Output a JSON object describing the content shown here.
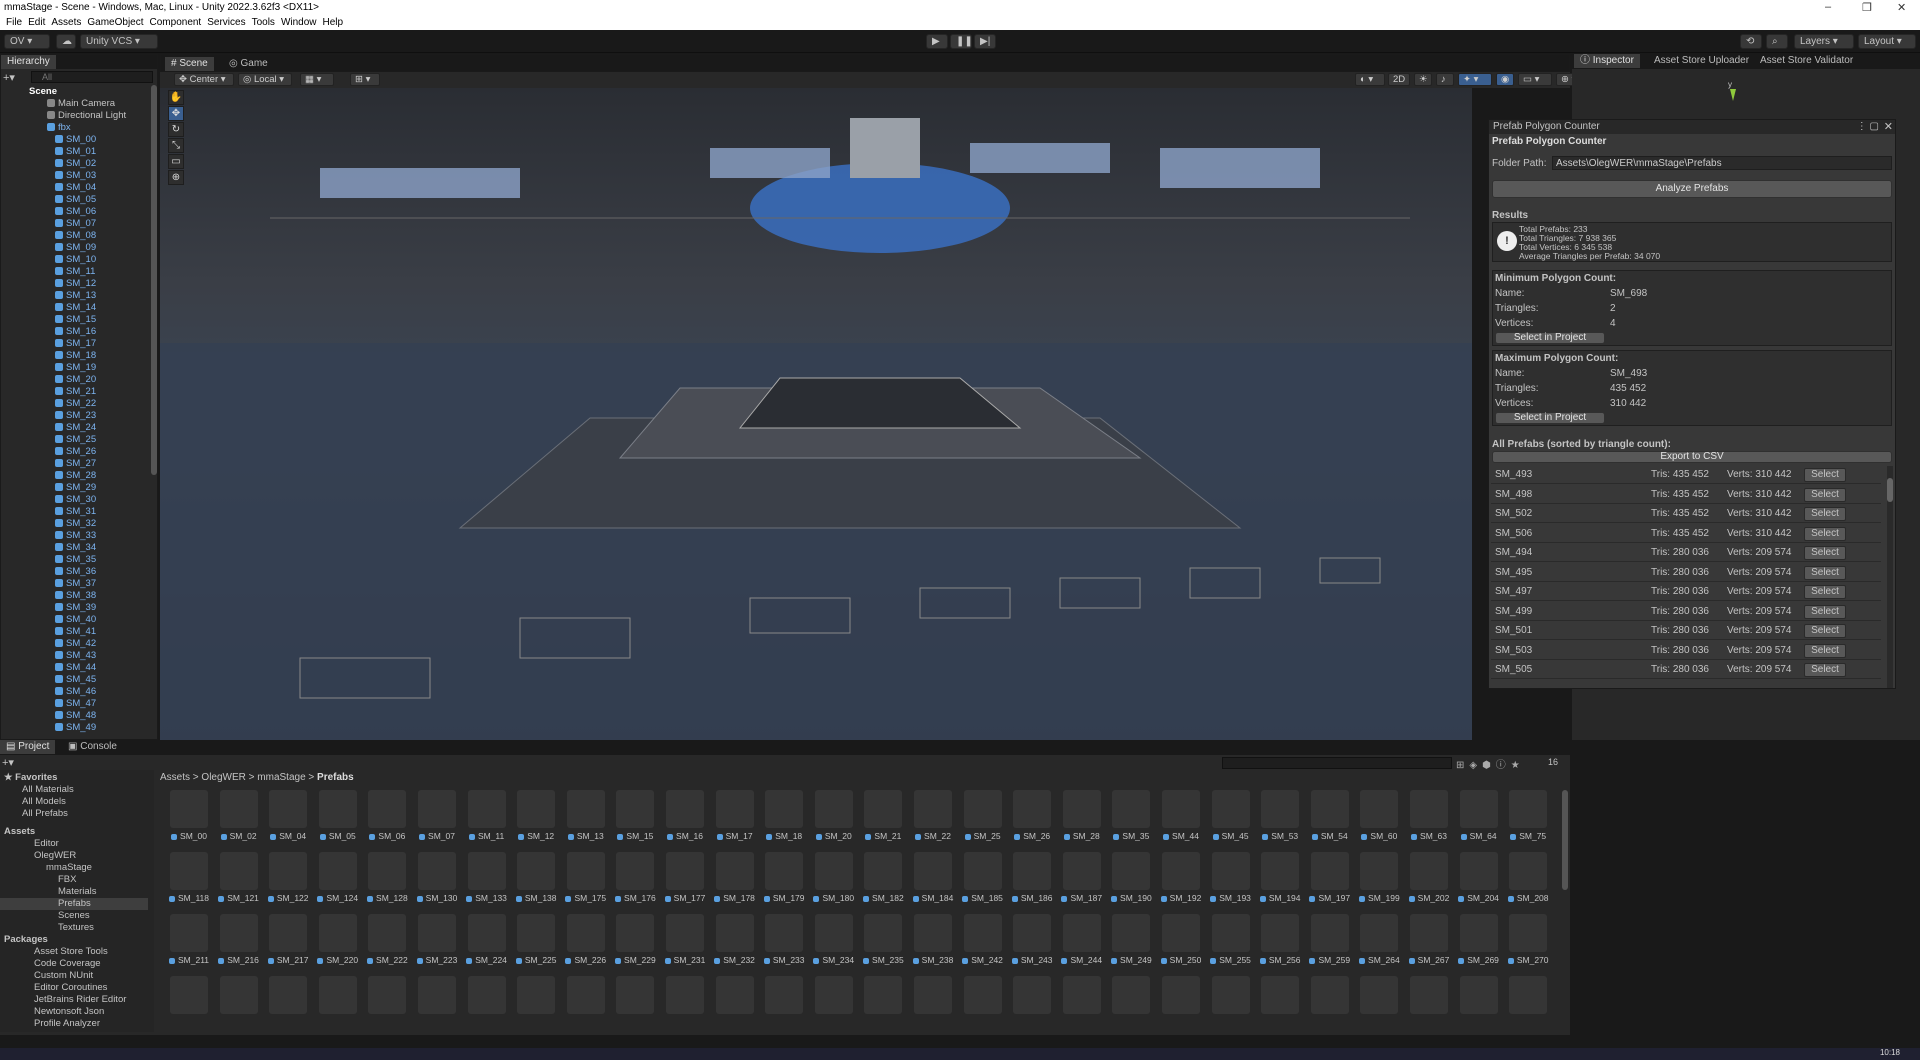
{
  "window": {
    "title": "mmaStage - Scene - Windows, Mac, Linux - Unity 2022.3.62f3 <DX11>"
  },
  "menu": [
    "File",
    "Edit",
    "Assets",
    "GameObject",
    "Component",
    "Services",
    "Tools",
    "Window",
    "Help"
  ],
  "toolbar": {
    "account": "OV",
    "vcs": "Unity VCS",
    "layers": "Layers",
    "layout": "Layout"
  },
  "hierarchy": {
    "tab": "Hierarchy",
    "search_placeholder": "All",
    "scene": "Scene",
    "main_camera": "Main Camera",
    "light": "Directional Light",
    "fbx": "fbx",
    "items": [
      "SM_00",
      "SM_01",
      "SM_02",
      "SM_03",
      "SM_04",
      "SM_05",
      "SM_06",
      "SM_07",
      "SM_08",
      "SM_09",
      "SM_10",
      "SM_11",
      "SM_12",
      "SM_13",
      "SM_14",
      "SM_15",
      "SM_16",
      "SM_17",
      "SM_18",
      "SM_19",
      "SM_20",
      "SM_21",
      "SM_22",
      "SM_23",
      "SM_24",
      "SM_25",
      "SM_26",
      "SM_27",
      "SM_28",
      "SM_29",
      "SM_30",
      "SM_31",
      "SM_32",
      "SM_33",
      "SM_34",
      "SM_35",
      "SM_36",
      "SM_37",
      "SM_38",
      "SM_39",
      "SM_40",
      "SM_41",
      "SM_42",
      "SM_43",
      "SM_44",
      "SM_45",
      "SM_46",
      "SM_47",
      "SM_48",
      "SM_49"
    ]
  },
  "scene": {
    "tab_scene": "Scene",
    "tab_game": "Game",
    "pivot": "Center",
    "space": "Local",
    "mode2d": "2D"
  },
  "inspector": {
    "tabs": [
      "Inspector",
      "Asset Store Uploader",
      "Asset Store Validator"
    ]
  },
  "ppc": {
    "window_title": "Prefab Polygon Counter",
    "header": "Prefab Polygon Counter",
    "folder_label": "Folder Path:",
    "folder_value": "Assets\\OlegWER\\mmaStage\\Prefabs",
    "analyze": "Analyze Prefabs",
    "results": "Results",
    "total_prefabs": "Total Prefabs: 233",
    "total_tris": "Total Triangles: 7 938 365",
    "total_verts": "Total Vertices: 6 345 538",
    "avg_tris": "Average Triangles per Prefab: 34 070",
    "min": {
      "title": "Minimum Polygon Count:",
      "name_l": "Name:",
      "name": "SM_698",
      "tri_l": "Triangles:",
      "tri": "2",
      "vert_l": "Vertices:",
      "vert": "4",
      "btn": "Select in Project"
    },
    "max": {
      "title": "Maximum Polygon Count:",
      "name_l": "Name:",
      "name": "SM_493",
      "tri_l": "Triangles:",
      "tri": "435 452",
      "vert_l": "Vertices:",
      "vert": "310 442",
      "btn": "Select in Project"
    },
    "all_title": "All Prefabs (sorted by triangle count):",
    "export": "Export to CSV",
    "select": "Select",
    "rows": [
      {
        "n": "SM_493",
        "t": "Tris: 435 452",
        "v": "Verts: 310 442"
      },
      {
        "n": "SM_498",
        "t": "Tris: 435 452",
        "v": "Verts: 310 442"
      },
      {
        "n": "SM_502",
        "t": "Tris: 435 452",
        "v": "Verts: 310 442"
      },
      {
        "n": "SM_506",
        "t": "Tris: 435 452",
        "v": "Verts: 310 442"
      },
      {
        "n": "SM_494",
        "t": "Tris: 280 036",
        "v": "Verts: 209 574"
      },
      {
        "n": "SM_495",
        "t": "Tris: 280 036",
        "v": "Verts: 209 574"
      },
      {
        "n": "SM_497",
        "t": "Tris: 280 036",
        "v": "Verts: 209 574"
      },
      {
        "n": "SM_499",
        "t": "Tris: 280 036",
        "v": "Verts: 209 574"
      },
      {
        "n": "SM_501",
        "t": "Tris: 280 036",
        "v": "Verts: 209 574"
      },
      {
        "n": "SM_503",
        "t": "Tris: 280 036",
        "v": "Verts: 209 574"
      },
      {
        "n": "SM_505",
        "t": "Tris: 280 036",
        "v": "Verts: 209 574"
      }
    ]
  },
  "project": {
    "tab_project": "Project",
    "tab_console": "Console",
    "count": "16",
    "breadcrumb": [
      "Assets",
      "OlegWER",
      "mmaStage",
      "Prefabs"
    ],
    "favorites": "Favorites",
    "fav_items": [
      "All Materials",
      "All Models",
      "All Prefabs"
    ],
    "assets": "Assets",
    "tree": [
      "Editor",
      "OlegWER",
      "mmaStage",
      "FBX",
      "Materials",
      "Prefabs",
      "Scenes",
      "Textures"
    ],
    "packages": "Packages",
    "pkgs": [
      "Asset Store Tools",
      "Code Coverage",
      "Custom NUnit",
      "Editor Coroutines",
      "JetBrains Rider Editor",
      "Newtonsoft Json",
      "Profile Analyzer"
    ],
    "grid": [
      [
        "SM_00",
        "SM_02",
        "SM_04",
        "SM_05",
        "SM_06",
        "SM_07",
        "SM_11",
        "SM_12",
        "SM_13",
        "SM_15",
        "SM_16",
        "SM_17",
        "SM_18",
        "SM_20",
        "SM_21",
        "SM_22",
        "SM_25",
        "SM_26",
        "SM_28",
        "SM_35",
        "SM_44",
        "SM_45",
        "SM_53",
        "SM_54",
        "SM_60",
        "SM_63",
        "SM_64",
        "SM_75"
      ],
      [
        "SM_118",
        "SM_121",
        "SM_122",
        "SM_124",
        "SM_128",
        "SM_130",
        "SM_133",
        "SM_138",
        "SM_175",
        "SM_176",
        "SM_177",
        "SM_178",
        "SM_179",
        "SM_180",
        "SM_182",
        "SM_184",
        "SM_185",
        "SM_186",
        "SM_187",
        "SM_190",
        "SM_192",
        "SM_193",
        "SM_194",
        "SM_197",
        "SM_199",
        "SM_202",
        "SM_204",
        "SM_208"
      ],
      [
        "SM_211",
        "SM_216",
        "SM_217",
        "SM_220",
        "SM_222",
        "SM_223",
        "SM_224",
        "SM_225",
        "SM_226",
        "SM_229",
        "SM_231",
        "SM_232",
        "SM_233",
        "SM_234",
        "SM_235",
        "SM_238",
        "SM_242",
        "SM_243",
        "SM_244",
        "SM_249",
        "SM_250",
        "SM_255",
        "SM_256",
        "SM_259",
        "SM_264",
        "SM_267",
        "SM_269",
        "SM_270"
      ]
    ]
  },
  "clock": "10:18"
}
